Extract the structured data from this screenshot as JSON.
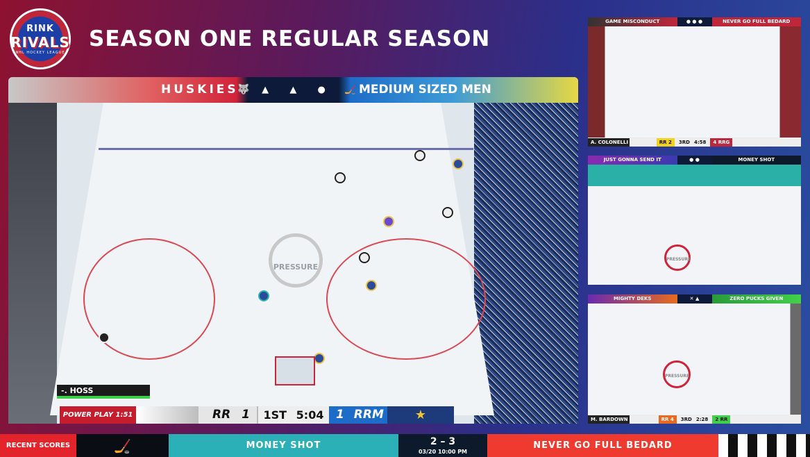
{
  "brand": {
    "logo_top": "RINK",
    "logo_main": "RIVALS",
    "logo_sub": "NHL HOCKEY LEAGUE"
  },
  "header": {
    "title": "SEASON ONE REGULAR SEASON"
  },
  "main_game": {
    "home_team": "HUSKIES",
    "away_team": "MEDIUM SIZED MEN",
    "center_icons": [
      "husky-icon",
      "husky-icon",
      "puck-dot-icon"
    ],
    "pressure_label": "PRESSURE",
    "player_tag": "-. HOSS",
    "power_play": "POWER PLAY 1:51",
    "home_abbr": "RR",
    "home_score": "1",
    "period": "1ST",
    "clock": "5:04",
    "away_score": "1",
    "away_abbr": "RRM"
  },
  "side_games": [
    {
      "home": "GAME MISCONDUCT",
      "away": "NEVER GO FULL BEDARD",
      "player_tag": "A. COLONELLI",
      "home_abbr": "RR",
      "home_score": "2",
      "period": "3RD",
      "clock": "4:58",
      "away_score": "4",
      "away_abbr": "RRG"
    },
    {
      "home": "JUST GONNA SEND IT",
      "away": "MONEY SHOT",
      "pressure_label": "PRESSURE"
    },
    {
      "home": "MIGHTY DEKS",
      "away": "ZERO PUCKS GIVEN",
      "pressure_label": "PRESSURE",
      "player_tag": "M. BARDOWN",
      "home_abbr": "RR",
      "home_score": "4",
      "period": "3RD",
      "clock": "2:28",
      "away_score": "2",
      "away_abbr": "RR"
    }
  ],
  "ticker": {
    "label": "RECENT SCORES",
    "team1": "MONEY SHOT",
    "score": "2 – 3",
    "datetime": "03/20 10:00 PM",
    "team2": "NEVER GO FULL BEDARD"
  },
  "colors": {
    "home_red": "#d0233a",
    "away_blue": "#1d6cc8",
    "ticker_teal": "#2bb0b8",
    "ticker_red": "#ef3a2f"
  }
}
